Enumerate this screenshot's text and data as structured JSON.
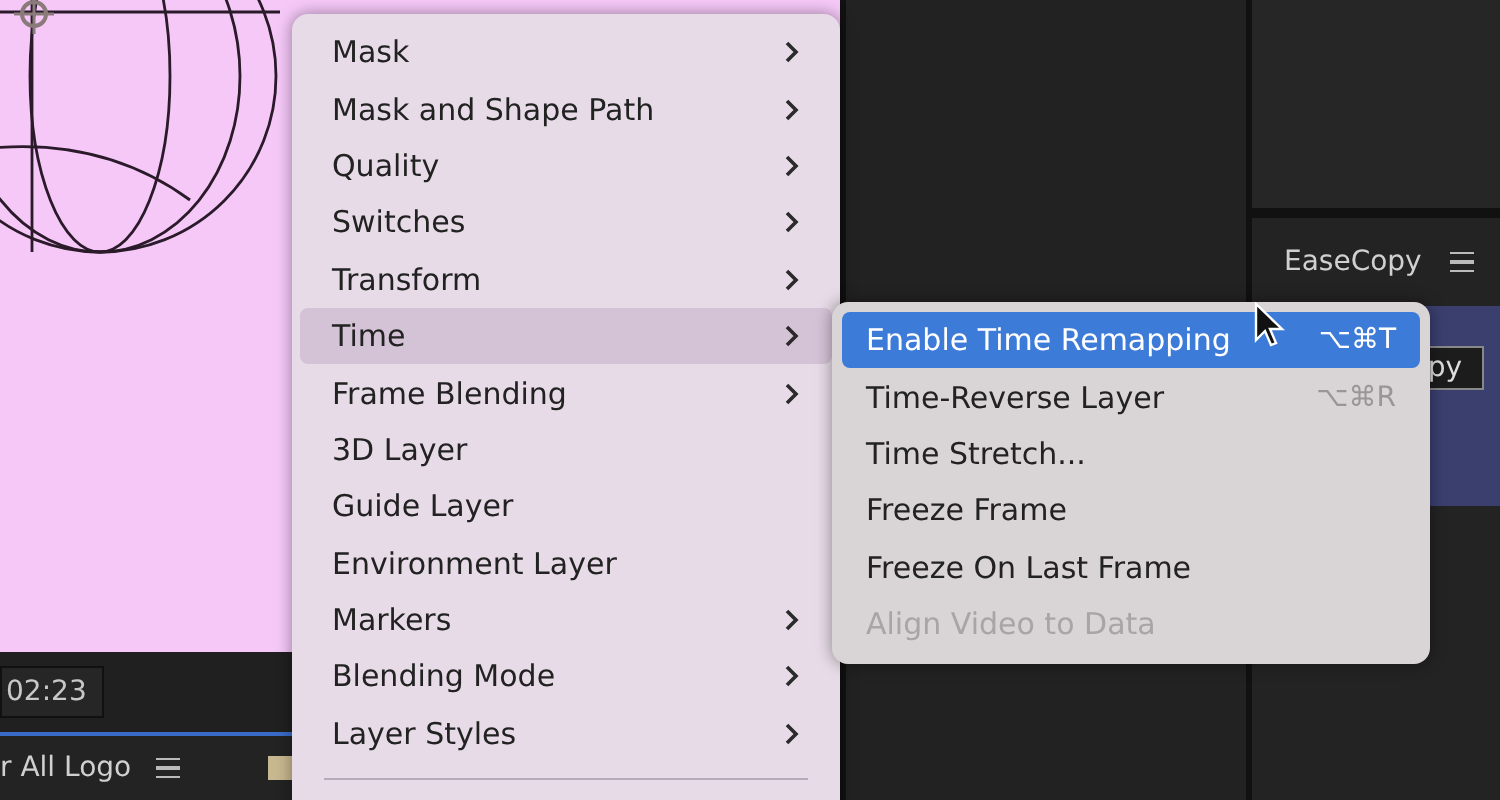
{
  "viewer": {
    "timecode": "02:23"
  },
  "timeline": {
    "tab": "r All Logo"
  },
  "panel": {
    "title": "EaseCopy",
    "button": "py"
  },
  "menu": {
    "items": [
      {
        "label": "Mask",
        "submenu": true,
        "selected": false
      },
      {
        "label": "Mask and Shape Path",
        "submenu": true,
        "selected": false
      },
      {
        "label": "Quality",
        "submenu": true,
        "selected": false
      },
      {
        "label": "Switches",
        "submenu": true,
        "selected": false
      },
      {
        "label": "Transform",
        "submenu": true,
        "selected": false
      },
      {
        "label": "Time",
        "submenu": true,
        "selected": true
      },
      {
        "label": "Frame Blending",
        "submenu": true,
        "selected": false
      },
      {
        "label": "3D Layer",
        "submenu": false,
        "selected": false
      },
      {
        "label": "Guide Layer",
        "submenu": false,
        "selected": false
      },
      {
        "label": "Environment Layer",
        "submenu": false,
        "selected": false
      },
      {
        "label": "Markers",
        "submenu": true,
        "selected": false
      },
      {
        "label": "Blending Mode",
        "submenu": true,
        "selected": false
      },
      {
        "label": "Layer Styles",
        "submenu": true,
        "selected": false
      }
    ]
  },
  "submenu": {
    "items": [
      {
        "label": "Enable Time Remapping",
        "shortcut": "⌥⌘T",
        "selected": true,
        "disabled": false
      },
      {
        "label": "Time-Reverse Layer",
        "shortcut": "⌥⌘R",
        "selected": false,
        "disabled": false
      },
      {
        "label": "Time Stretch...",
        "selected": false,
        "disabled": false
      },
      {
        "label": "Freeze Frame",
        "selected": false,
        "disabled": false
      },
      {
        "label": "Freeze On Last Frame",
        "selected": false,
        "disabled": false
      },
      {
        "label": "Align Video to Data",
        "selected": false,
        "disabled": true
      }
    ]
  }
}
